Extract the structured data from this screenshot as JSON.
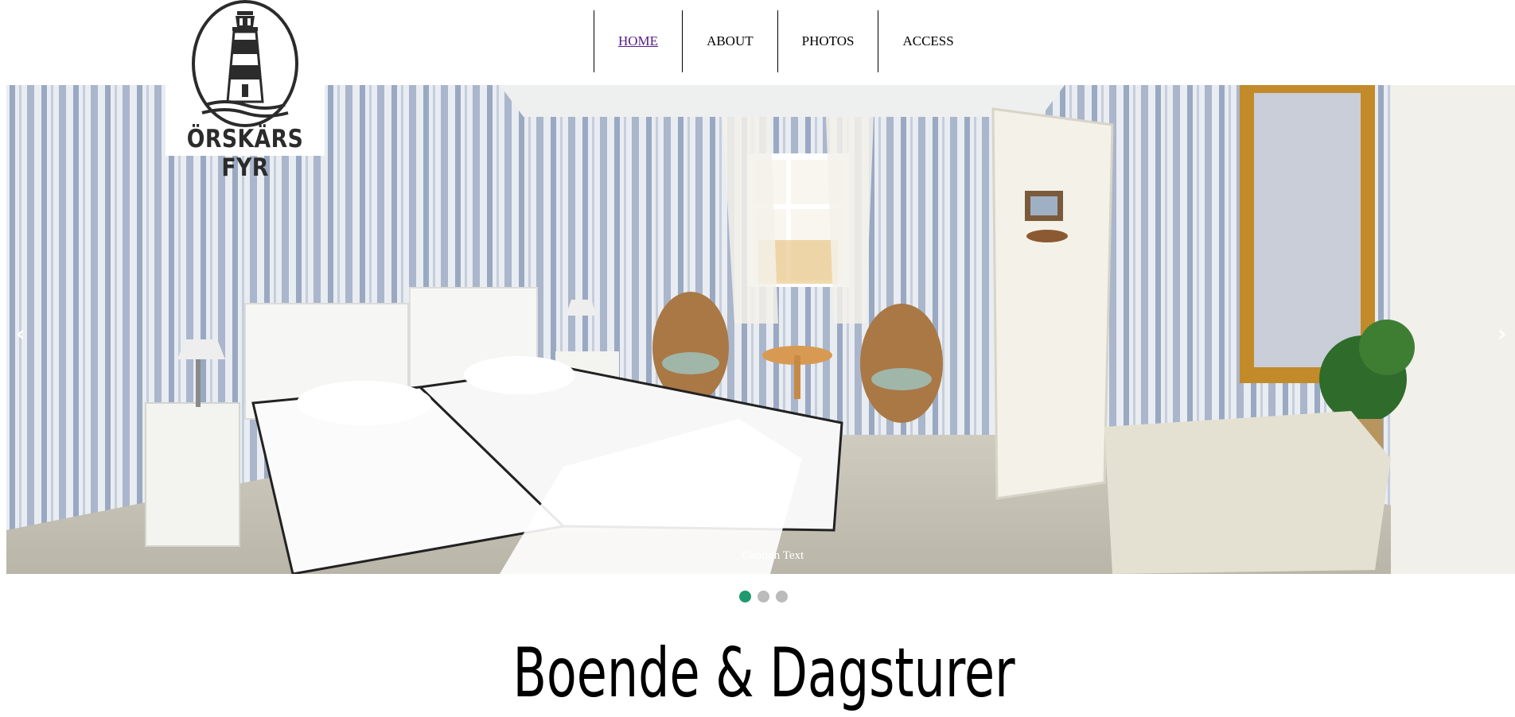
{
  "brand": {
    "logo_text": "ÖRSKÄRS FYR",
    "logo_icon": "lighthouse-icon"
  },
  "nav": {
    "items": [
      {
        "label": "HOME",
        "active": true
      },
      {
        "label": "ABOUT"
      },
      {
        "label": "PHOTOS"
      },
      {
        "label": "ACCESS"
      }
    ]
  },
  "slideshow": {
    "caption": "Caption Text",
    "prev_symbol": "‹",
    "next_symbol": "›",
    "dots": [
      {
        "active": true
      },
      {
        "active": false
      },
      {
        "active": false
      }
    ],
    "image_subject": "room-photo"
  },
  "main": {
    "heading": "Boende & Dagsturer"
  },
  "colors": {
    "active_dot": "#1f9a6f",
    "inactive_dot": "#bbbbbb",
    "visited_link": "#551a8b"
  }
}
